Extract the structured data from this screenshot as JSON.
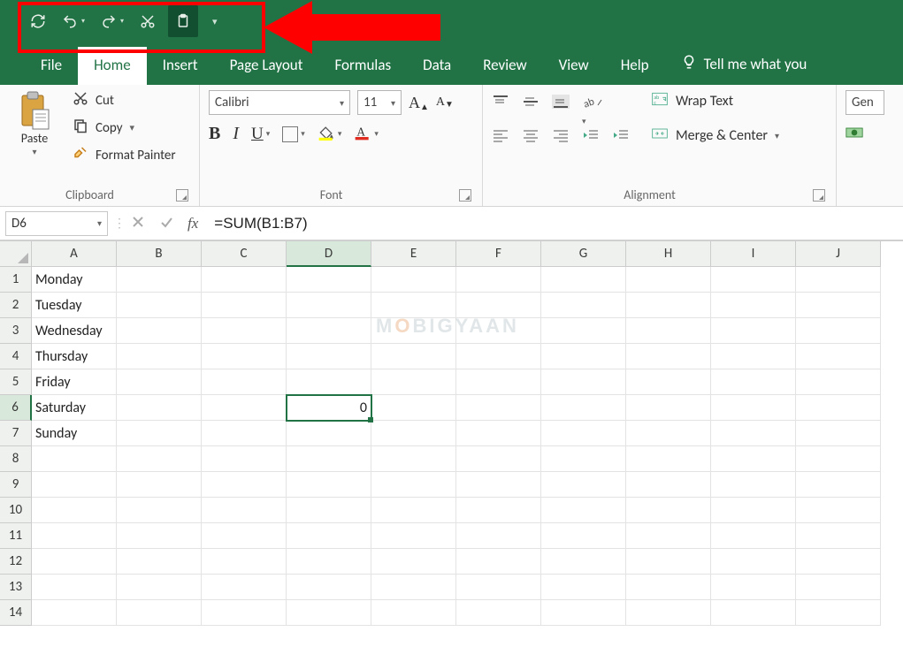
{
  "qat": {
    "buttons": [
      "refresh",
      "undo",
      "redo",
      "cut",
      "paste"
    ],
    "more": "▾"
  },
  "tabs": {
    "file": "File",
    "home": "Home",
    "insert": "Insert",
    "page_layout": "Page Layout",
    "formulas": "Formulas",
    "data": "Data",
    "review": "Review",
    "view": "View",
    "help": "Help",
    "tell_me": "Tell me what you"
  },
  "ribbon": {
    "clipboard": {
      "label": "Clipboard",
      "paste": "Paste",
      "cut": "Cut",
      "copy": "Copy",
      "format_painter": "Format Painter"
    },
    "font": {
      "label": "Font",
      "name": "Calibri",
      "size": "11"
    },
    "alignment": {
      "label": "Alignment",
      "wrap": "Wrap Text",
      "merge": "Merge & Center"
    },
    "number": {
      "format": "Gen"
    }
  },
  "formula_bar": {
    "name_box": "D6",
    "fx": "fx",
    "formula": "=SUM(B1:B7)"
  },
  "grid": {
    "columns": [
      "A",
      "B",
      "C",
      "D",
      "E",
      "F",
      "G",
      "H",
      "I",
      "J"
    ],
    "rows": [
      "1",
      "2",
      "3",
      "4",
      "5",
      "6",
      "7",
      "8",
      "9",
      "10",
      "11",
      "12",
      "13",
      "14"
    ],
    "active_col": "D",
    "active_row": "6",
    "cells": {
      "A1": "Monday",
      "A2": "Tuesday",
      "A3": "Wednesday",
      "A4": "Thursday",
      "A5": "Friday",
      "A6": "Saturday",
      "A7": "Sunday",
      "D6": "0"
    }
  },
  "watermark": "MOBIGYAAN"
}
